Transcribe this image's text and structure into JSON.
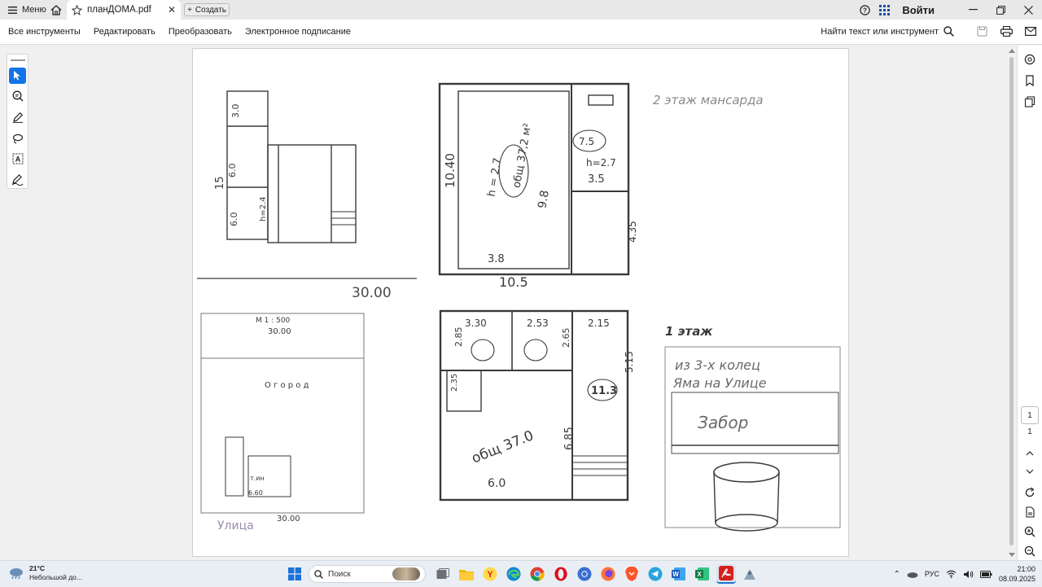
{
  "titlebar": {
    "menu_label": "Меню",
    "tab_title": "планДОМА.pdf",
    "create_label": "Создать",
    "signin_label": "Войти"
  },
  "toolbar": {
    "items": [
      "Все инструменты",
      "Редактировать",
      "Преобразовать",
      "Электронное подписание"
    ],
    "find_label": "Найти текст или инструмент"
  },
  "page_nav": {
    "current": "1",
    "total": "1"
  },
  "document": {
    "label_top_left_total": "30.00",
    "label_scale": "М 1 : 500",
    "label_scale_width": "30.00",
    "label_garden": "О г о р о д",
    "label_street": "Улица",
    "label_street_width": "30.00",
    "label_floor2": "2 этаж мансарда",
    "label_floor1": "1 этаж",
    "label_floor2_width": "10.5",
    "label_floor2_height": "10.40",
    "label_floor2_area": "общ 37,2 м²",
    "label_floor2_h": "h = 2.7",
    "label_floor2_room_w": "3.8",
    "label_floor2_9_8": "9.8",
    "label_floor2_right_area": "7.5",
    "label_floor2_right_h": "h=2.7",
    "label_floor2_right_w": "3.5",
    "label_floor2_right_4_35": "4.35",
    "label_floor1_area": "общ 37.0",
    "label_floor1_w": "6.0",
    "label_floor1_6_85": "6.85",
    "label_floor1_3_30": "3.30",
    "label_floor1_2_53": "2.53",
    "label_floor1_2_15": "2.15",
    "label_floor1_2_65": "2.65",
    "label_floor1_2_85": "2.85",
    "label_floor1_11_3": "11.3",
    "label_floor1_5_15": "5.15",
    "label_floor1_2_35": "2.35",
    "label_floor1_sketch_1": "из 3-х колец",
    "label_floor1_sketch_2": "Яма на Улице",
    "label_fence": "Забор",
    "label_left_3_0": "3.0",
    "label_left_6_0a": "6.0",
    "label_left_6_0b": "6.0",
    "label_left_15": "15",
    "label_left_h": "h=2.4",
    "label_site_6_60": "6.60",
    "label_site_tuh": "т.ин"
  },
  "taskbar": {
    "weather_temp": "21°C",
    "weather_desc": "Небольшой до...",
    "search_placeholder": "Поиск",
    "lang": "РУС",
    "time": "21:00",
    "date": "08.09.2025"
  }
}
